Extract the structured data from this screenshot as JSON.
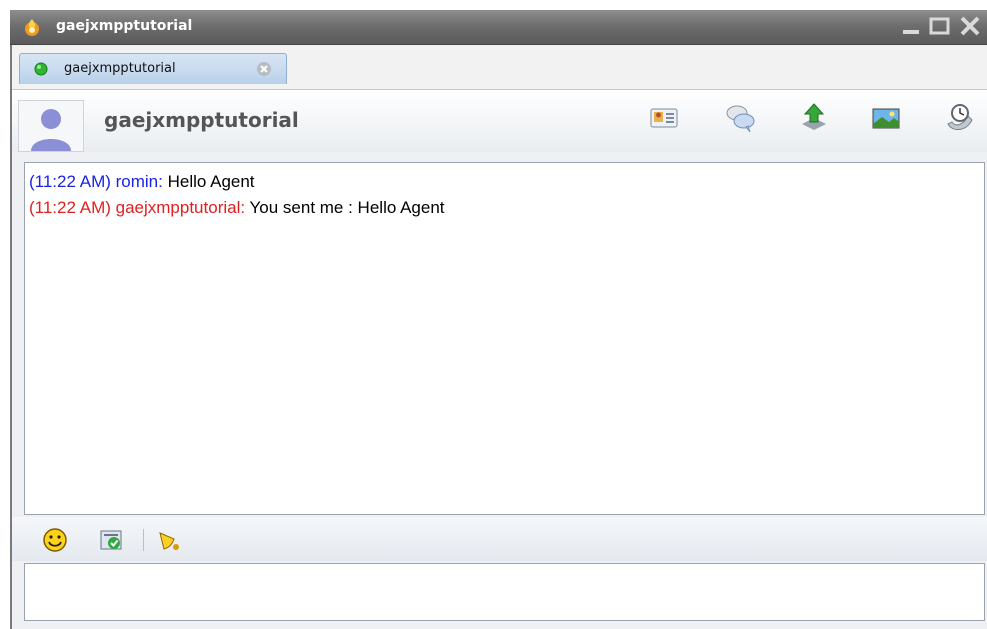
{
  "window": {
    "title": "gaejxmpptutorial"
  },
  "tab": {
    "label": "gaejxmpptutorial",
    "status_color": "#2fb52f"
  },
  "header": {
    "contact_name": "gaejxmpptutorial",
    "toolbar_icons": [
      "contact-card-icon",
      "chat-bubbles-icon",
      "send-file-icon",
      "image-icon",
      "history-icon"
    ]
  },
  "transcript": {
    "messages": [
      {
        "time": "(11:22 AM)",
        "sender": "romin:",
        "text": " Hello Agent",
        "sender_color": "#1a23e6"
      },
      {
        "time": "(11:22 AM)",
        "sender": "gaejxmpptutorial:",
        "text": " You sent me : Hello Agent",
        "sender_color": "#e02020"
      }
    ]
  },
  "input_toolbar": {
    "icons": [
      "emoticon-icon",
      "spell-check-icon",
      "nudge-icon"
    ]
  },
  "colors": {
    "titlebar": "#6e6e6e",
    "accent": "#8fb0d6"
  }
}
